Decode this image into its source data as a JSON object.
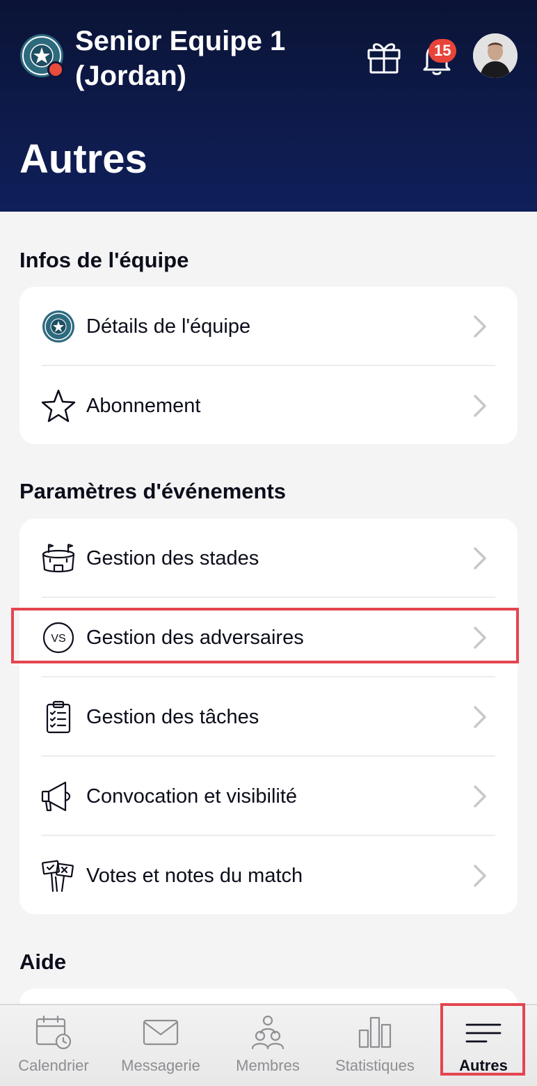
{
  "header": {
    "team_name": "Senior Equipe 1 (Jordan)",
    "notification_count": "15",
    "page_title": "Autres",
    "bg_color": "#0f1f5a",
    "badge_color": "#e8443a"
  },
  "sections": {
    "team_info": {
      "title": "Infos de l'équipe",
      "items": [
        {
          "label": "Détails de l'équipe",
          "icon": "team-logo-icon"
        },
        {
          "label": "Abonnement",
          "icon": "star-icon"
        }
      ]
    },
    "event_settings": {
      "title": "Paramètres d'événements",
      "items": [
        {
          "label": "Gestion des stades",
          "icon": "stadium-icon"
        },
        {
          "label": "Gestion des adversaires",
          "icon": "versus-icon"
        },
        {
          "label": "Gestion des tâches",
          "icon": "clipboard-checklist-icon"
        },
        {
          "label": "Convocation et visibilité",
          "icon": "megaphone-icon"
        },
        {
          "label": "Votes et notes du match",
          "icon": "vote-signs-icon"
        }
      ]
    },
    "help": {
      "title": "Aide"
    }
  },
  "tabbar": {
    "tabs": [
      {
        "label": "Calendrier",
        "icon": "calendar-clock-icon"
      },
      {
        "label": "Messagerie",
        "icon": "envelope-icon"
      },
      {
        "label": "Membres",
        "icon": "members-icon"
      },
      {
        "label": "Statistiques",
        "icon": "bar-chart-icon"
      },
      {
        "label": "Autres",
        "icon": "menu-lines-icon",
        "active": true
      }
    ]
  },
  "highlight_color": "#e4454f"
}
